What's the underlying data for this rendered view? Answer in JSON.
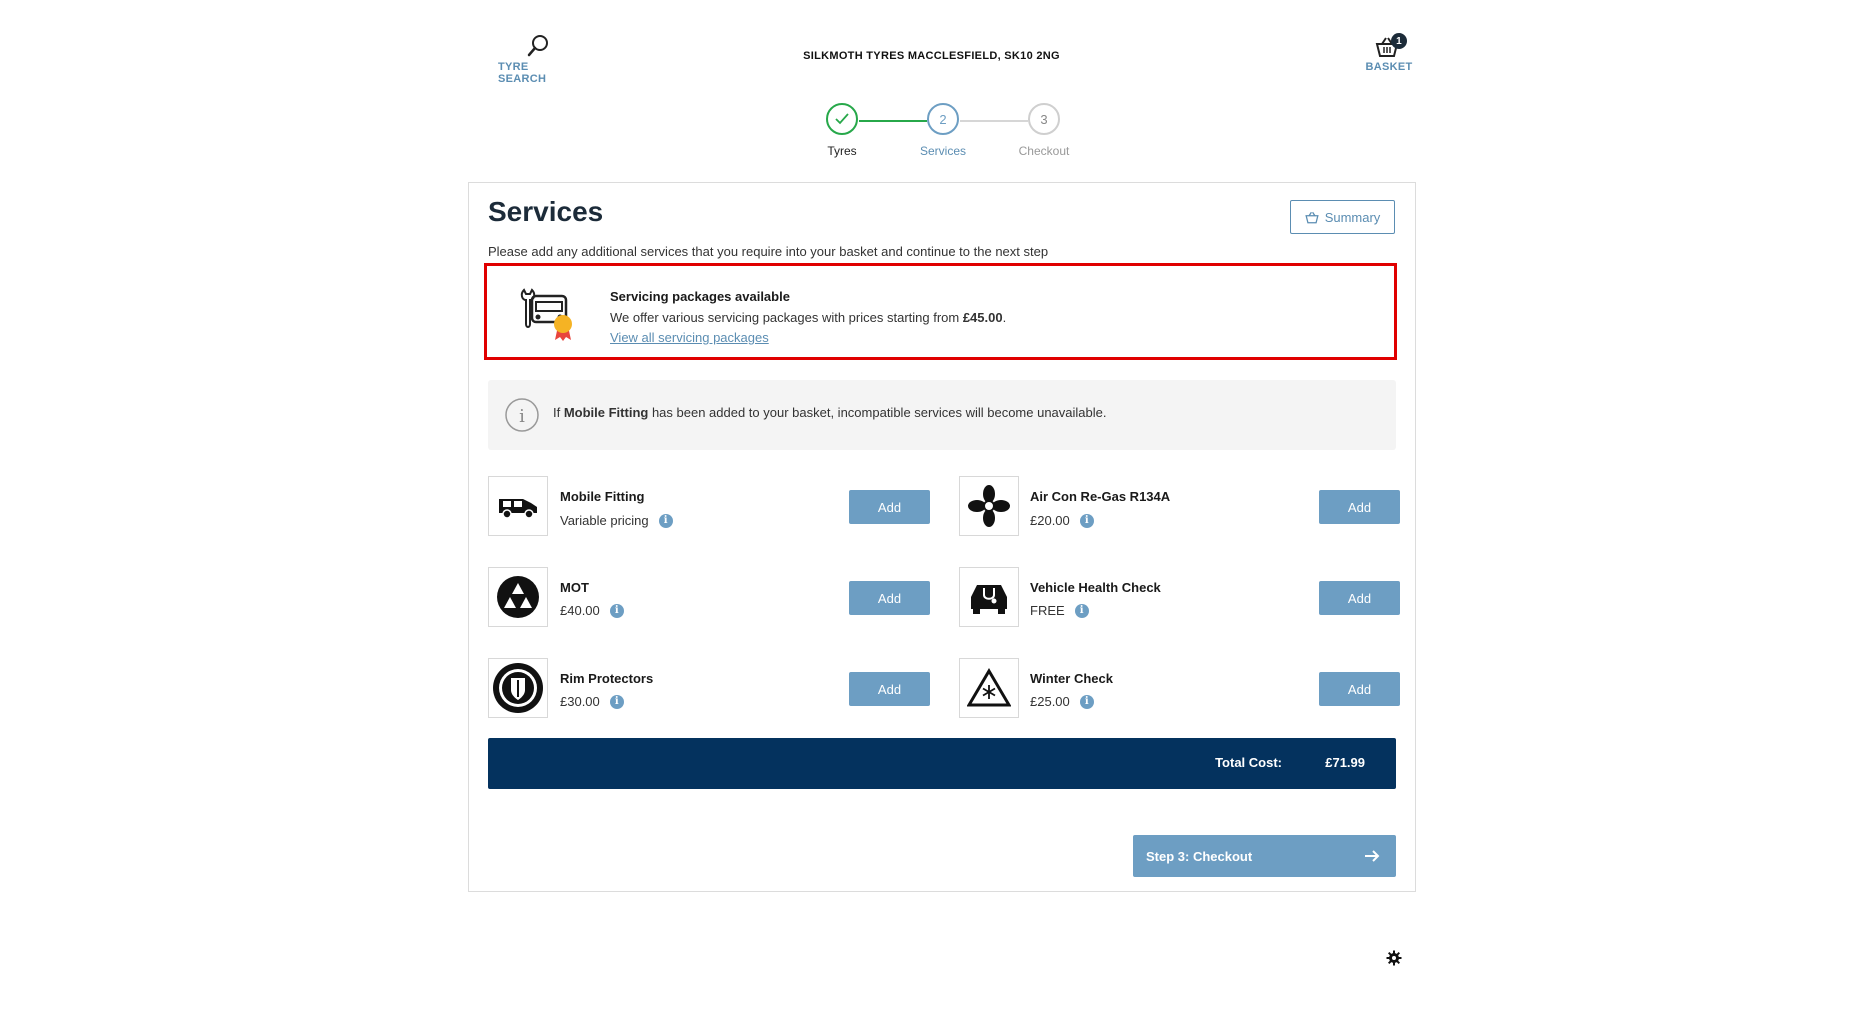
{
  "header": {
    "search_label": "TYRE SEARCH",
    "store_name": "SILKMOTH TYRES MACCLESFIELD, SK10 2NG",
    "basket_label": "BASKET",
    "basket_count": "1"
  },
  "steps": [
    {
      "number": "",
      "label": "Tyres",
      "state": "done"
    },
    {
      "number": "2",
      "label": "Services",
      "state": "active"
    },
    {
      "number": "3",
      "label": "Checkout",
      "state": "pending"
    }
  ],
  "page": {
    "title": "Services",
    "summary_label": "Summary",
    "intro": "Please add any additional services that you require into your basket and continue to the next step"
  },
  "promo": {
    "title": "Servicing packages available",
    "text_prefix": "We offer various servicing packages with prices starting from ",
    "price": "£45.00",
    "text_suffix": ".",
    "link": "View all servicing packages"
  },
  "notice": {
    "prefix": "If ",
    "bold": "Mobile Fitting",
    "suffix": " has been added to your basket, incompatible services will become unavailable."
  },
  "services": [
    {
      "name": "Mobile Fitting",
      "price": "Variable pricing",
      "icon": "van-icon",
      "button": "Add"
    },
    {
      "name": "Air Con Re-Gas R134A",
      "price": "£20.00",
      "icon": "fan-icon",
      "button": "Add"
    },
    {
      "name": "MOT",
      "price": "£40.00",
      "icon": "mot-triangles-icon",
      "button": "Add"
    },
    {
      "name": "Vehicle Health Check",
      "price": "FREE",
      "icon": "car-stethoscope-icon",
      "button": "Add"
    },
    {
      "name": "Rim Protectors",
      "price": "£30.00",
      "icon": "rim-shield-icon",
      "button": "Add"
    },
    {
      "name": "Winter Check",
      "price": "£25.00",
      "icon": "snow-warning-icon",
      "button": "Add"
    }
  ],
  "total": {
    "label": "Total Cost:",
    "value": "£71.99"
  },
  "checkout": {
    "label": "Step 3: Checkout",
    "arrow_icon": "arrow-right-icon"
  },
  "colors": {
    "accent": "#6d9ec3",
    "navy": "#04325e",
    "success": "#27a84a",
    "promo_border": "#e00000"
  }
}
